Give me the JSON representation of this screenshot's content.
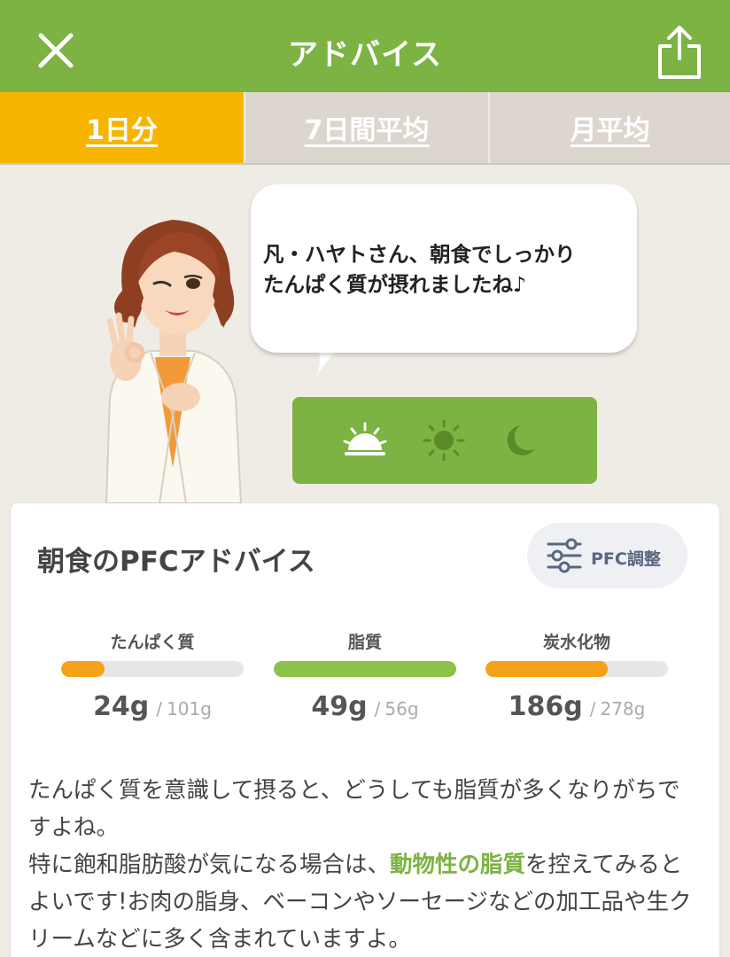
{
  "header": {
    "title": "アドバイス",
    "close_icon": "close-icon",
    "share_icon": "share-icon",
    "bg_color": "#7cb342"
  },
  "tabs": [
    {
      "label": "1日分",
      "active": true
    },
    {
      "label": "7日間平均",
      "active": false
    },
    {
      "label": "月平均",
      "active": false
    }
  ],
  "advisor": {
    "message": "凡・ハヤトさん、朝食でしっかり\nたんぱく質が摂れましたね♪"
  },
  "meal_selector": {
    "items": [
      {
        "icon": "sunrise-icon",
        "meal": "breakfast",
        "active": true
      },
      {
        "icon": "sun-icon",
        "meal": "lunch",
        "active": false
      },
      {
        "icon": "moon-icon",
        "meal": "dinner",
        "active": false
      }
    ]
  },
  "pfc": {
    "title": "朝食のPFCアドバイス",
    "adjust_label": "PFC調整",
    "nutrients": [
      {
        "label": "たんぱく質",
        "amount": "24g",
        "target": "101g",
        "fraction": 0.24,
        "color": "#f5a11a"
      },
      {
        "label": "脂質",
        "amount": "49g",
        "target": "56g",
        "fraction": 1.0,
        "color": "#8bc34a"
      },
      {
        "label": "炭水化物",
        "amount": "186g",
        "target": "278g",
        "fraction": 0.67,
        "color": "#f5a11a"
      }
    ]
  },
  "advice": {
    "line1": "たんぱく質を意識して摂ると、どうしても脂質が多くなりがちですよね。",
    "line2_pre": "特に飽和脂肪酸が気になる場合は、",
    "line2_highlight": "動物性の脂質",
    "line2_post": "を控えてみるとよいです!お肉の脂身、ベーコンやソーセージなどの加工品や生クリームなどに多く含まれていますよ。"
  }
}
